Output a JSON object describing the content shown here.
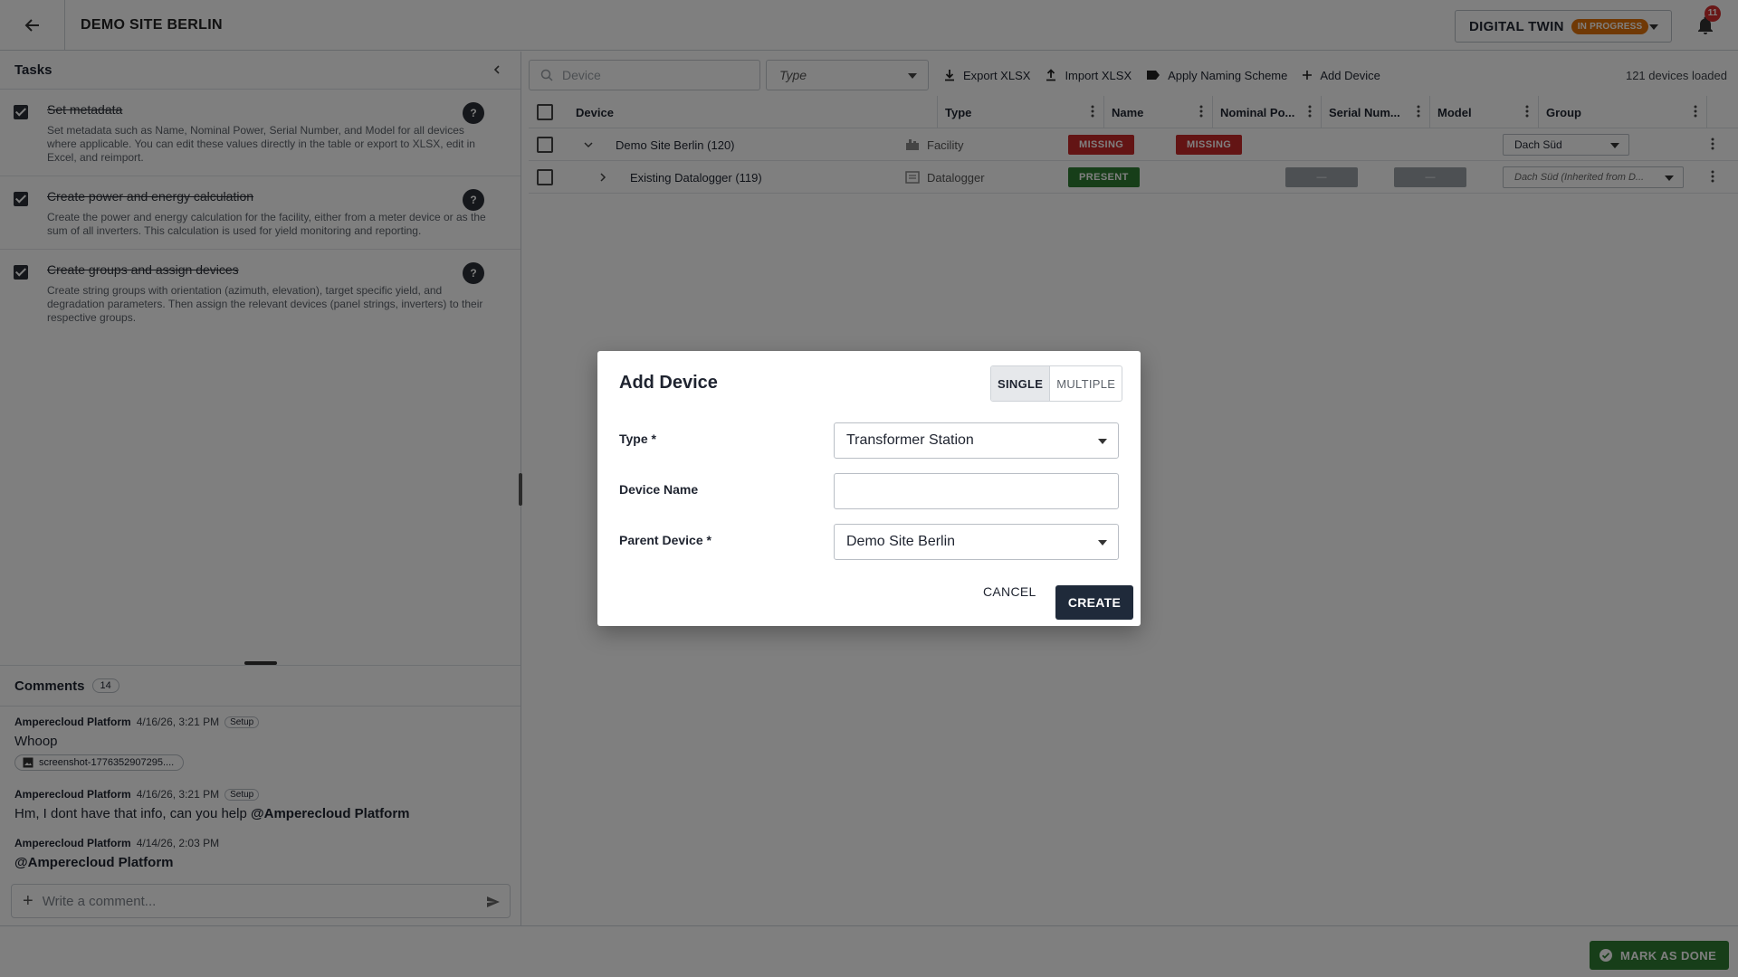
{
  "header": {
    "title": "DEMO SITE BERLIN",
    "twin_label": "DIGITAL TWIN",
    "twin_status": "IN PROGRESS",
    "notification_count": "11"
  },
  "tasks": {
    "title": "Tasks",
    "items": [
      {
        "title": "Set metadata",
        "description": "Set metadata such as Name, Nominal Power, Serial Number, and Model for all devices where applicable. You can edit these values directly in the table or export to XLSX, edit in Excel, and reimport.",
        "help": "?"
      },
      {
        "title": "Create power and energy calculation",
        "description": "Create the power and energy calculation for the facility, either from a meter device or as the sum of all inverters. This calculation is used for yield monitoring and reporting.",
        "help": "?"
      },
      {
        "title": "Create groups and assign devices",
        "description": "Create string groups with orientation (azimuth, elevation), target specific yield, and degradation parameters. Then assign the relevant devices (panel strings, inverters) to their respective groups.",
        "help": "?"
      }
    ]
  },
  "comments": {
    "title": "Comments",
    "count": "14",
    "items": [
      {
        "author": "Amperecloud Platform",
        "time": "4/16/26, 3:21 PM",
        "tag": "Setup",
        "text": "Whoop",
        "attachment": "screenshot-1776352907295...."
      },
      {
        "author": "Amperecloud Platform",
        "time": "4/16/26, 3:21 PM",
        "tag": "Setup",
        "text": "Hm, I dont have that info, can you help ",
        "mention": "@Amperecloud Platform"
      },
      {
        "author": "Amperecloud Platform",
        "time": "4/14/26, 2:03 PM",
        "mention": "@Amperecloud Platform"
      }
    ],
    "input_placeholder": "Write a comment..."
  },
  "toolbar": {
    "search_placeholder": "Device",
    "type_placeholder": "Type",
    "export_label": "Export XLSX",
    "import_label": "Import XLSX",
    "naming_label": "Apply Naming Scheme",
    "add_label": "Add Device",
    "devices_loaded": "121 devices loaded"
  },
  "grid": {
    "columns": [
      "Device",
      "Type",
      "Name",
      "Nominal Po...",
      "Serial Num...",
      "Model",
      "Group"
    ],
    "rows": [
      {
        "device": "Demo Site Berlin (120)",
        "type": "Facility",
        "name_status": "MISSING",
        "nominal_status": "MISSING",
        "serial": "",
        "model": "",
        "group": "Dach Süd"
      },
      {
        "device": "Existing Datalogger (119)",
        "type": "Datalogger",
        "name_status": "PRESENT",
        "nominal_status": "",
        "serial": "—",
        "model": "—",
        "group": "Dach Süd (Inherited from D..."
      }
    ]
  },
  "footer": {
    "mark_done": "MARK AS DONE"
  },
  "dialog": {
    "title": "Add Device",
    "mode_single": "SINGLE",
    "mode_multiple": "MULTIPLE",
    "type_label": "Type *",
    "type_value": "Transformer Station",
    "name_label": "Device Name",
    "name_value": "",
    "parent_label": "Parent Device *",
    "parent_value": "Demo Site Berlin",
    "cancel": "CANCEL",
    "create": "CREATE"
  },
  "colors": {
    "missing": "#c62828",
    "present": "#2e7d32",
    "in_progress": "#e0720a",
    "primary": "#1f2a3a"
  }
}
